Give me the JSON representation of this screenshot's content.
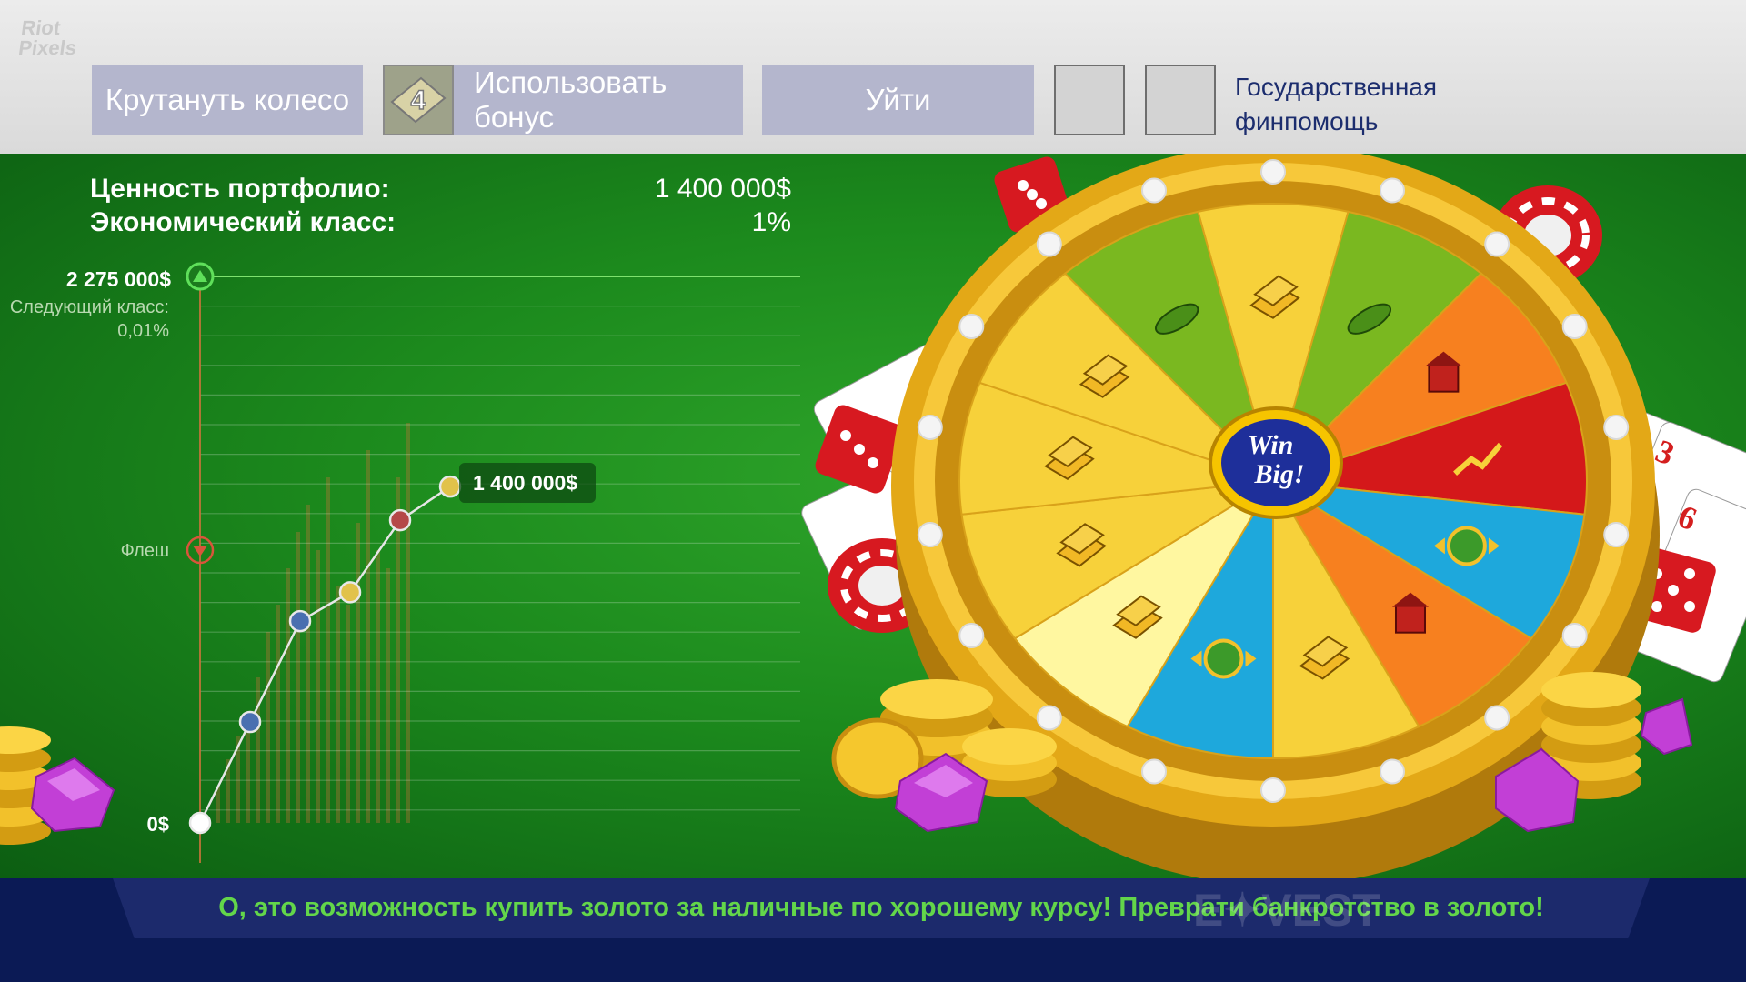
{
  "watermark": {
    "line1": "Riot",
    "line2": "Pixels"
  },
  "toolbar": {
    "spin_label": "Крутануть колесо",
    "bonus_label": "Использовать бонус",
    "bonus_count": "4",
    "exit_label": "Уйти",
    "state_aid_line1": "Государственная",
    "state_aid_line2": "финпомощь"
  },
  "stats": {
    "portfolio_label": "Ценность портфолио:",
    "portfolio_value": "1 400 000$",
    "class_label": "Экономический класс:",
    "class_value": "1%"
  },
  "chart": {
    "top_label": "2 275 000$",
    "next_class_label": "Следующий класс:",
    "next_class_value": "0,01%",
    "flash_label": "Флеш",
    "zero_label": "0$",
    "current_label": "1 400 000$"
  },
  "chart_data": {
    "type": "line",
    "ylim": [
      0,
      2275000
    ],
    "y_marks": [
      {
        "label": "Следующий класс",
        "value": 2275000
      },
      {
        "label": "Флеш",
        "value": 1400000
      }
    ],
    "points": [
      {
        "x": 0,
        "y": 0,
        "color": "#ffffff"
      },
      {
        "x": 1,
        "y": 420000,
        "color": "#4a6fb0"
      },
      {
        "x": 2,
        "y": 840000,
        "color": "#4a6fb0"
      },
      {
        "x": 3,
        "y": 960000,
        "color": "#e1c24a"
      },
      {
        "x": 4,
        "y": 1260000,
        "color": "#b54848"
      },
      {
        "x": 5,
        "y": 1400000,
        "color": "#e1c24a"
      }
    ]
  },
  "wheel": {
    "center_line1": "Win",
    "center_line2": "Big!",
    "segments": [
      {
        "type": "gold",
        "color": "#f7d13a"
      },
      {
        "type": "soybeans",
        "color": "#7ab820"
      },
      {
        "type": "real-estate",
        "color": "#f7801f"
      },
      {
        "type": "stocks",
        "color": "#d4181a"
      },
      {
        "type": "cash-exchange",
        "color": "#1ea8dc"
      },
      {
        "type": "real-estate",
        "color": "#f7801f"
      },
      {
        "type": "gold",
        "color": "#f7d13a"
      },
      {
        "type": "cash-exchange",
        "color": "#1ea8dc"
      },
      {
        "type": "gold-selected",
        "color": "#fff7a0"
      },
      {
        "type": "gold",
        "color": "#f7d13a"
      },
      {
        "type": "gold",
        "color": "#f7d13a"
      },
      {
        "type": "gold",
        "color": "#f7d13a"
      },
      {
        "type": "soybeans",
        "color": "#7ab820"
      }
    ]
  },
  "banner": {
    "message": "О, это возможность купить золото за наличные по хорошему курсу! Преврати банкротство в золото!",
    "logo": "E✦VEST"
  }
}
